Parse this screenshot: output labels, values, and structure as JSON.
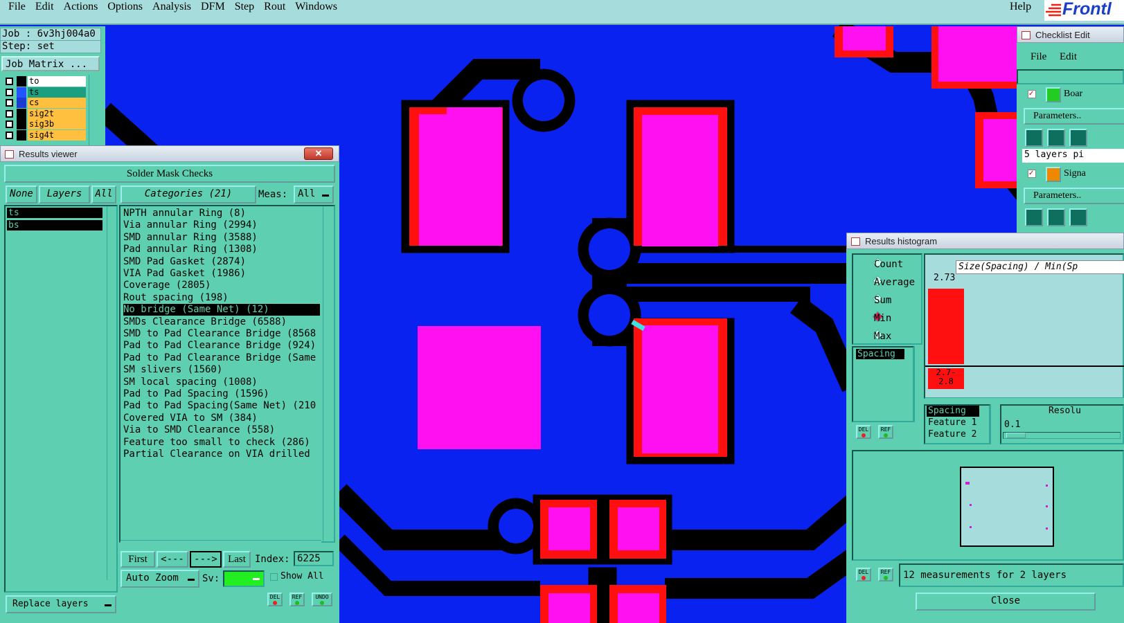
{
  "menubar": {
    "items": [
      "File",
      "Edit",
      "Actions",
      "Options",
      "Analysis",
      "DFM",
      "Step",
      "Rout",
      "Windows"
    ],
    "help": "Help",
    "logo": "Frontl"
  },
  "job_panel": {
    "job": "Job : 6v3hj004a0",
    "step": "Step: set",
    "job_matrix": "Job Matrix ...",
    "layers": [
      {
        "name": "to",
        "color": "#ffffff",
        "swatch": "#000000"
      },
      {
        "name": "ts",
        "color": "#1aa080",
        "swatch": "#2255ff"
      },
      {
        "name": "cs",
        "color": "#ffc040",
        "swatch": "#1a3cd0"
      },
      {
        "name": "sig2t",
        "color": "#ffc040",
        "swatch": "#000000"
      },
      {
        "name": "sig3b",
        "color": "#ffc040",
        "swatch": "#000000"
      },
      {
        "name": "sig4t",
        "color": "#ffc040",
        "swatch": "#000000"
      }
    ]
  },
  "results_viewer": {
    "title": "Results viewer",
    "header": "Solder Mask Checks",
    "none_label": "None",
    "layers_label": "Layers",
    "all_label": "All",
    "categories_label": "Categories (21)",
    "meas_label": "Meas:",
    "meas_value": "All",
    "layers": [
      "ts",
      "bs"
    ],
    "categories": [
      "NPTH annular Ring (8)",
      "Via annular Ring (2994)",
      "SMD annular Ring (3588)",
      "Pad annular Ring (1308)",
      "SMD Pad Gasket (2874)",
      "VIA Pad Gasket (1986)",
      "Coverage (2805)",
      "Rout spacing (198)",
      "No bridge (Same Net) (12)",
      "SMDs Clearance Bridge (6588)",
      "SMD to Pad Clearance Bridge (8568",
      "Pad to Pad Clearance Bridge (924)",
      "Pad to Pad Clearance Bridge (Same",
      "SM slivers (1560)",
      "SM local spacing (1008)",
      "Pad to Pad Spacing (1596)",
      "Pad to Pad Spacing(Same Net) (210",
      "Covered VIA to SM (384)",
      "Via to SMD Clearance (558)",
      "Feature too small to check (286)",
      "Partial Clearance on VIA drilled"
    ],
    "selected_category": 8,
    "first": "First",
    "prev": "<---",
    "next": "--->",
    "last": "Last",
    "index_label": "Index:",
    "index_value": "6225",
    "auto_zoom": "Auto Zoom",
    "sv_label": "Sv:",
    "show_all": "Show All",
    "replace_layers": "Replace layers",
    "del": "DEL",
    "ref": "REF",
    "undo": "UNDO"
  },
  "checklist": {
    "title": "Checklist Edit",
    "menu": [
      "File",
      "Edit"
    ],
    "item1": "Boar",
    "parameters": "Parameters..",
    "layers_text": "5 layers pi",
    "item2": "Signa"
  },
  "histogram": {
    "title": "Results histogram",
    "modes": [
      "Count",
      "Average",
      "Sum",
      "Min",
      "Max"
    ],
    "selected_mode": "Min",
    "list_item": "Spacing",
    "chart_title": "Size(Spacing) / Min(Sp",
    "bar_value": "2.73",
    "bar_range": "2.7-\n2.8",
    "bar_fraction": 0.85,
    "fields": [
      "Spacing",
      "Feature 1",
      "Feature 2"
    ],
    "resolution_label": "Resolu",
    "resolution_value": "0.1",
    "measurements": "12 measurements for 2 layers",
    "close": "Close"
  },
  "colors": {
    "background": "#0a22f0",
    "pad": "#ff10f0",
    "mask": "#ff1010",
    "trace": "#000000",
    "panel": "#5ecfb0",
    "menubar": "#a6dcdc"
  }
}
